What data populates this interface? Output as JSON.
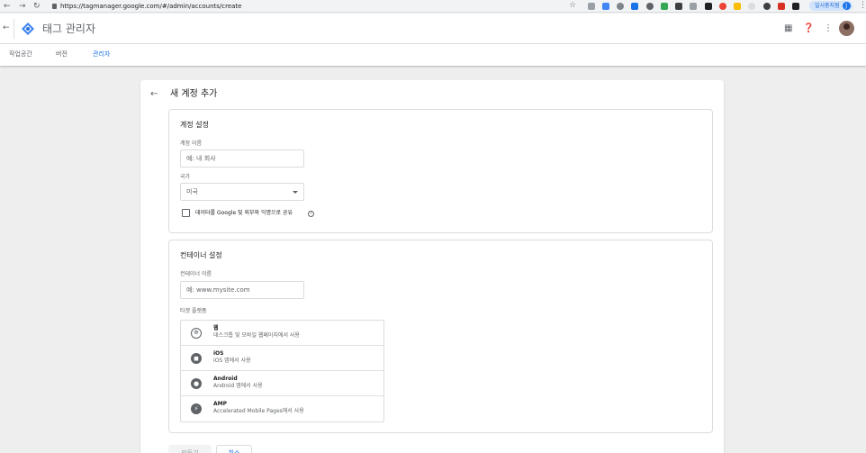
{
  "browser": {
    "url": "https://tagmanager.google.com/#/admin/accounts/create",
    "profile_label": "일시중지됨",
    "profile_initial": "J"
  },
  "app": {
    "title": "태그 관리자",
    "tabs": [
      {
        "label": "작업공간"
      },
      {
        "label": "버전"
      },
      {
        "label": "관리자"
      }
    ]
  },
  "page": {
    "title": "새 계정 추가"
  },
  "account_settings": {
    "title": "계정 설정",
    "name_label": "계정 이름",
    "name_placeholder": "예: 내 회사",
    "country_label": "국가",
    "country_value": "미국",
    "share_label": "데이터를 Google 및 외부와 익명으로 공유"
  },
  "container_settings": {
    "title": "컨테이너 설정",
    "name_label": "컨테이너 이름",
    "name_placeholder": "예: www.mysite.com",
    "platform_label": "타겟 플랫폼",
    "platforms": [
      {
        "name": "웹",
        "desc": "데스크톱 및 모바일 웹페이지에서 사용",
        "icon": "globe-icon"
      },
      {
        "name": "iOS",
        "desc": "iOS 앱에서 사용",
        "icon": "ios-icon"
      },
      {
        "name": "Android",
        "desc": "Android 앱에서 사용",
        "icon": "android-icon"
      },
      {
        "name": "AMP",
        "desc": "Accelerated Mobile Pages에서 사용",
        "icon": "amp-icon"
      }
    ]
  },
  "buttons": {
    "create": "만들기",
    "cancel": "취소"
  },
  "colors": {
    "accent": "#1a73e8",
    "background": "#eeeeee"
  }
}
